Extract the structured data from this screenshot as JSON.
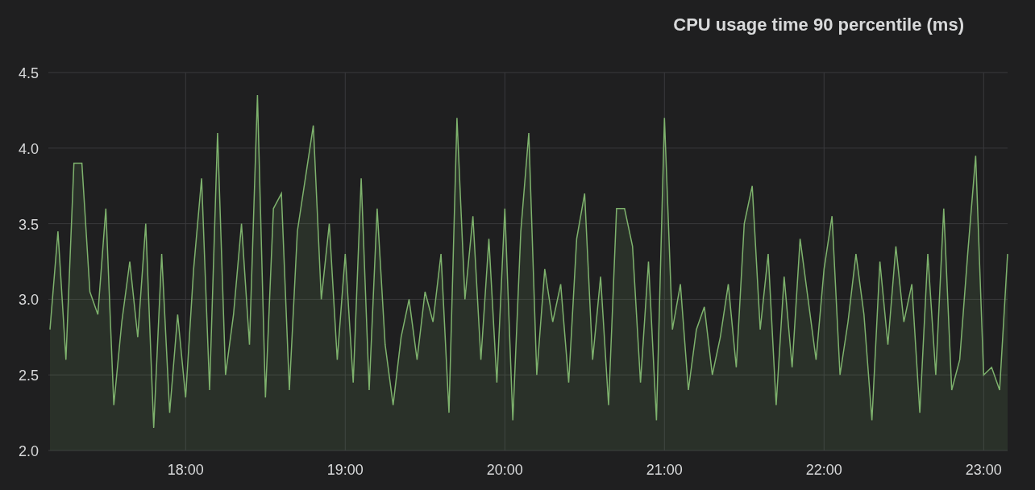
{
  "panel": {
    "title": "CPU usage time 90 percentile (ms)",
    "chart_data": {
      "type": "area",
      "grid": true,
      "x": [
        17.15,
        17.2,
        17.25,
        17.3,
        17.35,
        17.4,
        17.45,
        17.5,
        17.55,
        17.6,
        17.65,
        17.7,
        17.75,
        17.8,
        17.85,
        17.9,
        17.95,
        18.0,
        18.05,
        18.1,
        18.15,
        18.2,
        18.25,
        18.3,
        18.35,
        18.4,
        18.45,
        18.5,
        18.55,
        18.6,
        18.65,
        18.7,
        18.75,
        18.8,
        18.85,
        18.9,
        18.95,
        19.0,
        19.05,
        19.1,
        19.15,
        19.2,
        19.25,
        19.3,
        19.35,
        19.4,
        19.45,
        19.5,
        19.55,
        19.6,
        19.65,
        19.7,
        19.75,
        19.8,
        19.85,
        19.9,
        19.95,
        20.0,
        20.05,
        20.1,
        20.15,
        20.2,
        20.25,
        20.3,
        20.35,
        20.4,
        20.45,
        20.5,
        20.55,
        20.6,
        20.65,
        20.7,
        20.75,
        20.8,
        20.85,
        20.9,
        20.95,
        21.0,
        21.05,
        21.1,
        21.15,
        21.2,
        21.25,
        21.3,
        21.35,
        21.4,
        21.45,
        21.5,
        21.55,
        21.6,
        21.65,
        21.7,
        21.75,
        21.8,
        21.85,
        21.9,
        21.95,
        22.0,
        22.05,
        22.1,
        22.15,
        22.2,
        22.25,
        22.3,
        22.35,
        22.4,
        22.45,
        22.5,
        22.55,
        22.6,
        22.65,
        22.7,
        22.75,
        22.8,
        22.85,
        22.9,
        22.95,
        23.0,
        23.05,
        23.1,
        23.15
      ],
      "xlim": [
        17.14,
        23.15
      ],
      "ylim": [
        2,
        4.5
      ],
      "xticks": [
        {
          "value": 18,
          "label": "18:00"
        },
        {
          "value": 19,
          "label": "19:00"
        },
        {
          "value": 20,
          "label": "20:00"
        },
        {
          "value": 21,
          "label": "21:00"
        },
        {
          "value": 22,
          "label": "22:00"
        },
        {
          "value": 23,
          "label": "23:00"
        }
      ],
      "yticks": [
        {
          "value": 2,
          "label": "2.0"
        },
        {
          "value": 2.5,
          "label": "2.5"
        },
        {
          "value": 3,
          "label": "3.0"
        },
        {
          "value": 3.5,
          "label": "3.5"
        },
        {
          "value": 4,
          "label": "4.0"
        },
        {
          "value": 4.5,
          "label": "4.5"
        }
      ],
      "series": [
        {
          "color": "#7eb26d",
          "values": [
            2.8,
            3.45,
            2.6,
            3.9,
            3.9,
            3.05,
            2.9,
            3.6,
            2.3,
            2.85,
            3.25,
            2.75,
            3.5,
            2.15,
            3.3,
            2.25,
            2.9,
            2.35,
            3.2,
            3.8,
            2.4,
            4.1,
            2.5,
            2.9,
            3.5,
            2.7,
            4.35,
            2.35,
            3.6,
            3.7,
            2.4,
            3.45,
            3.8,
            4.15,
            3.0,
            3.5,
            2.6,
            3.3,
            2.45,
            3.8,
            2.4,
            3.6,
            2.7,
            2.3,
            2.75,
            3.0,
            2.6,
            3.05,
            2.85,
            3.3,
            2.25,
            4.2,
            3.0,
            3.55,
            2.6,
            3.4,
            2.45,
            3.6,
            2.2,
            3.45,
            4.1,
            2.5,
            3.2,
            2.85,
            3.1,
            2.45,
            3.4,
            3.7,
            2.6,
            3.15,
            2.3,
            3.6,
            3.6,
            3.35,
            2.45,
            3.25,
            2.2,
            4.2,
            2.8,
            3.1,
            2.4,
            2.8,
            2.95,
            2.5,
            2.75,
            3.1,
            2.55,
            3.5,
            3.75,
            2.8,
            3.3,
            2.3,
            3.15,
            2.55,
            3.4,
            3.0,
            2.6,
            3.2,
            3.55,
            2.5,
            2.85,
            3.3,
            2.9,
            2.2,
            3.25,
            2.7,
            3.35,
            2.85,
            3.1,
            2.25,
            3.3,
            2.5,
            3.6,
            2.4,
            2.6,
            3.3,
            3.95,
            2.5,
            2.55,
            2.4,
            3.3
          ]
        }
      ]
    }
  }
}
